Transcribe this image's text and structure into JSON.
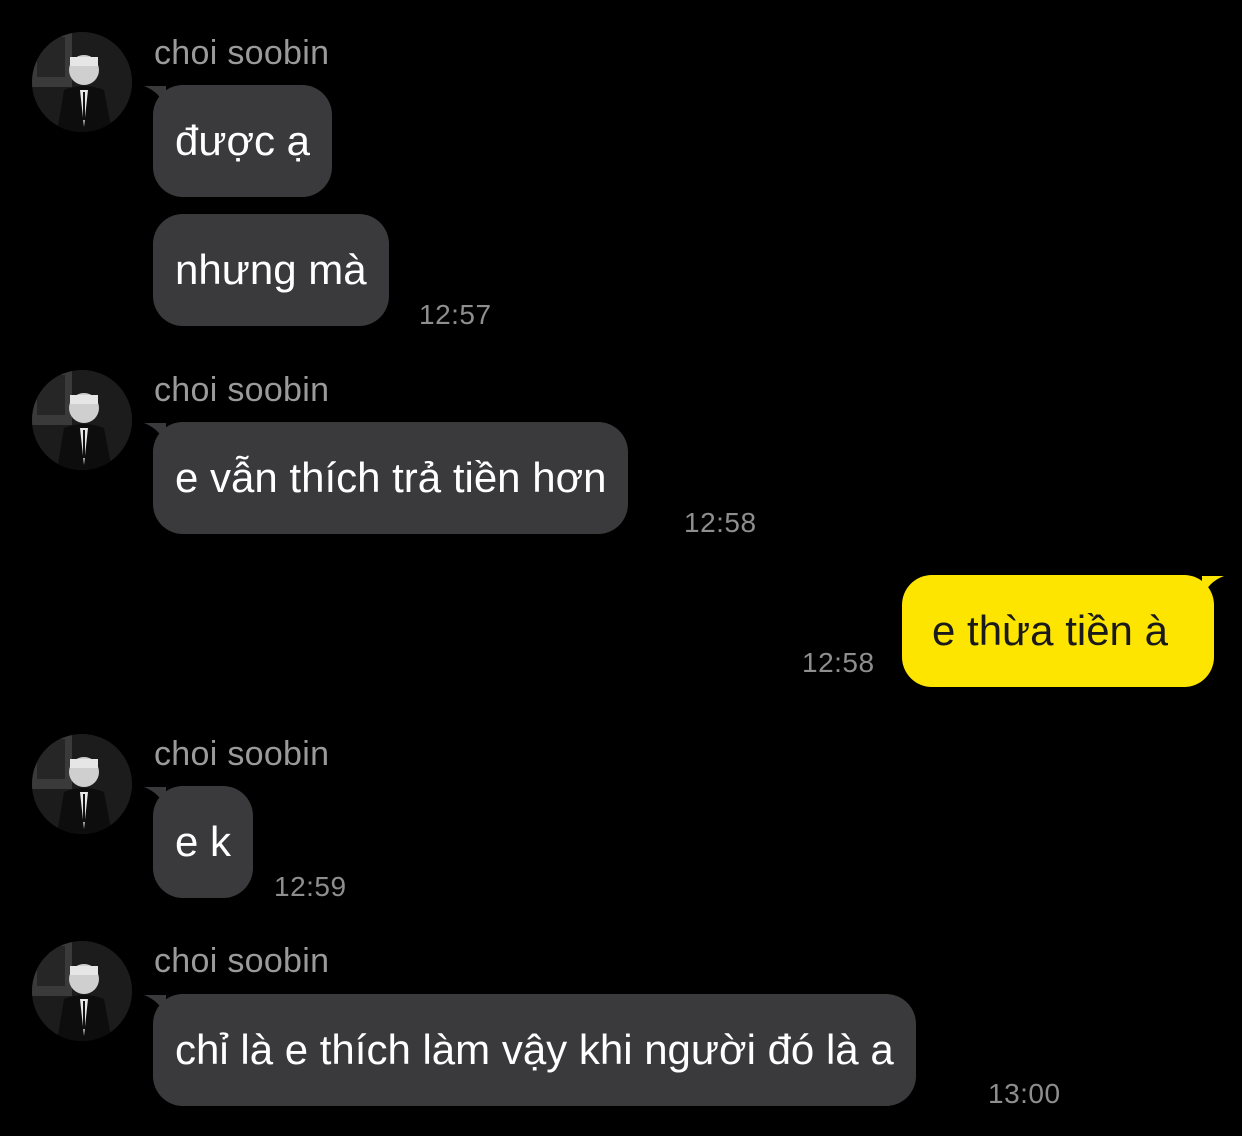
{
  "colors": {
    "background": "#000000",
    "incoming_bubble": "#3a3a3c",
    "outgoing_bubble": "#fee500",
    "sender_name": "#9a9a9a",
    "timestamp": "#8e8e8e"
  },
  "messages": [
    {
      "sender": "choi soobin",
      "direction": "incoming",
      "bubbles": [
        "được ạ",
        "nhưng mà"
      ],
      "time": "12:57"
    },
    {
      "sender": "choi soobin",
      "direction": "incoming",
      "bubbles": [
        "e vẫn thích trả tiền hơn"
      ],
      "time": "12:58"
    },
    {
      "direction": "outgoing",
      "bubbles": [
        "e thừa tiền à"
      ],
      "time": "12:58"
    },
    {
      "sender": "choi soobin",
      "direction": "incoming",
      "bubbles": [
        "e k"
      ],
      "time": "12:59"
    },
    {
      "sender": "choi soobin",
      "direction": "incoming",
      "bubbles": [
        "chỉ là e thích làm vậy khi người đó là a"
      ],
      "time": "13:00"
    }
  ]
}
